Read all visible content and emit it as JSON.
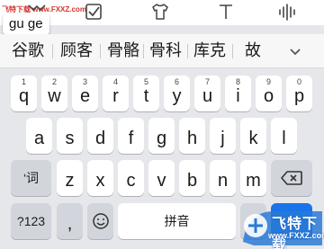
{
  "watermark": {
    "top_text": "飞特下载 www.FXXZ.com",
    "logo_text": "飞特下载",
    "logo_url": "www.FXXZ.com"
  },
  "toolbar": {
    "icons": [
      "emoji-icon",
      "checkbox-icon",
      "shirt-icon",
      "text-icon",
      "voice-icon"
    ]
  },
  "composition": {
    "text": "gu ge"
  },
  "candidates": {
    "items": [
      "谷歌",
      "顾客",
      "骨骼",
      "骨科",
      "库克",
      "故"
    ],
    "expand_icon": "chevron-down-icon"
  },
  "keyboard": {
    "row1": [
      {
        "label": "q",
        "hint": "1"
      },
      {
        "label": "w",
        "hint": "2"
      },
      {
        "label": "e",
        "hint": "3"
      },
      {
        "label": "r",
        "hint": "4"
      },
      {
        "label": "t",
        "hint": "5"
      },
      {
        "label": "y",
        "hint": "6"
      },
      {
        "label": "u",
        "hint": "7"
      },
      {
        "label": "i",
        "hint": "8"
      },
      {
        "label": "o",
        "hint": "9"
      },
      {
        "label": "p",
        "hint": "0"
      }
    ],
    "row2": [
      "a",
      "s",
      "d",
      "f",
      "g",
      "h",
      "j",
      "k",
      "l"
    ],
    "row3": [
      "z",
      "x",
      "c",
      "v",
      "b",
      "n",
      "m"
    ],
    "shift_label": "‘词",
    "symbols_label": "?123",
    "comma_label": ",",
    "space_label": "拼音",
    "backspace_icon": "backspace-icon",
    "emoji_key_icon": "emoji-icon",
    "accent_color": "#1a73e8"
  }
}
